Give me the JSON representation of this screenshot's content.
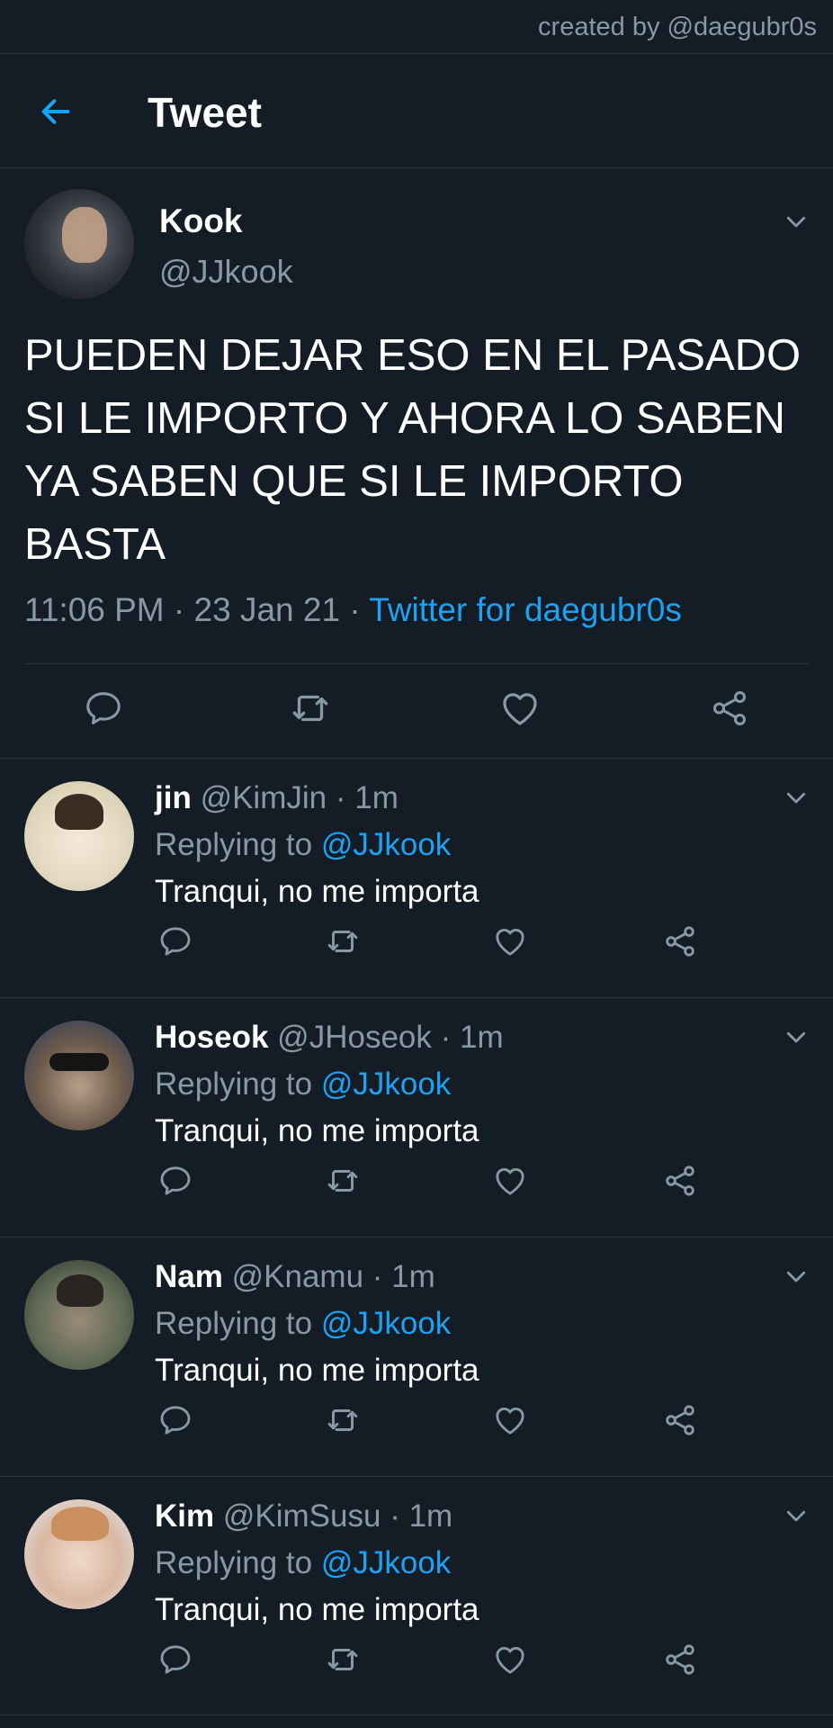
{
  "credit": "created by @daegubr0s",
  "header": {
    "title": "Tweet"
  },
  "main_tweet": {
    "name": "Kook",
    "handle": "@JJkook",
    "text": "PUEDEN DEJAR ESO EN EL PASADO SI LE IMPORTO Y AHORA LO SABEN YA SABEN QUE SI LE IMPORTO BASTA",
    "time": "11:06 PM",
    "date": "23 Jan 21",
    "source": "Twitter for daegubr0s"
  },
  "replies": [
    {
      "name": "jin",
      "handle": "@KimJin",
      "age": "1m",
      "replying_label": "Replying to",
      "mention": "@JJkook",
      "text": "Tranqui, no me importa"
    },
    {
      "name": "Hoseok",
      "handle": "@JHoseok",
      "age": "1m",
      "replying_label": "Replying to",
      "mention": "@JJkook",
      "text": "Tranqui, no me importa"
    },
    {
      "name": "Nam",
      "handle": "@Knamu",
      "age": "1m",
      "replying_label": "Replying to",
      "mention": "@JJkook",
      "text": "Tranqui, no me importa"
    },
    {
      "name": "Kim",
      "handle": "@KimSusu",
      "age": "1m",
      "replying_label": "Replying to",
      "mention": "@JJkook",
      "text": "Tranqui, no me importa"
    }
  ],
  "colors": {
    "background": "#141d26",
    "accent": "#1da1f2",
    "muted": "#8899a6",
    "divider": "#2a3540"
  },
  "icons": [
    "back-arrow-icon",
    "chevron-down-icon",
    "reply-icon",
    "retweet-icon",
    "like-icon",
    "share-icon"
  ]
}
